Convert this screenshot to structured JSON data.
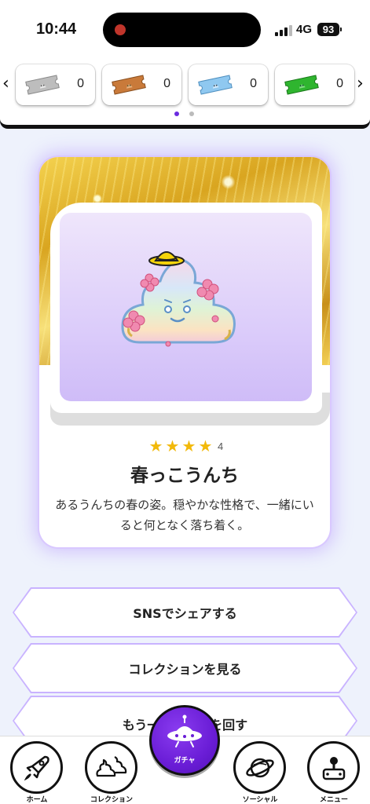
{
  "status_bar": {
    "time": "10:44",
    "network": "4G",
    "battery": "93"
  },
  "tickets": [
    {
      "icon": "silver-ticket-icon",
      "color": "#bdbdbd",
      "count": "0"
    },
    {
      "icon": "bronze-ticket-icon",
      "color": "#c97a3a",
      "count": "0"
    },
    {
      "icon": "blue-ticket-icon",
      "color": "#8fc8f0",
      "count": "0"
    },
    {
      "icon": "green-ticket-icon",
      "color": "#2fb52f",
      "count": "0"
    }
  ],
  "carousel": {
    "page": 1,
    "total": 2,
    "active_color": "#6a2be0",
    "inactive_color": "#bbbbbb"
  },
  "card": {
    "stars": "★★★★",
    "rarity": "4",
    "name": "春っこうんち",
    "description": "あるうんちの春の姿。穏やかな性格で、一緒にいると何となく落ち着く。"
  },
  "buttons": {
    "share": "SNSでシェアする",
    "collection": "コレクションを見る",
    "again": "もう一回ガチャを回す"
  },
  "nav": {
    "home": "ホーム",
    "collection": "コレクション",
    "gacha": "ガチャ",
    "social": "ソーシャル",
    "menu": "メニュー"
  },
  "colors": {
    "accent": "#6a1dd6",
    "star": "#f2b90a",
    "glow": "#c9b3ff"
  }
}
